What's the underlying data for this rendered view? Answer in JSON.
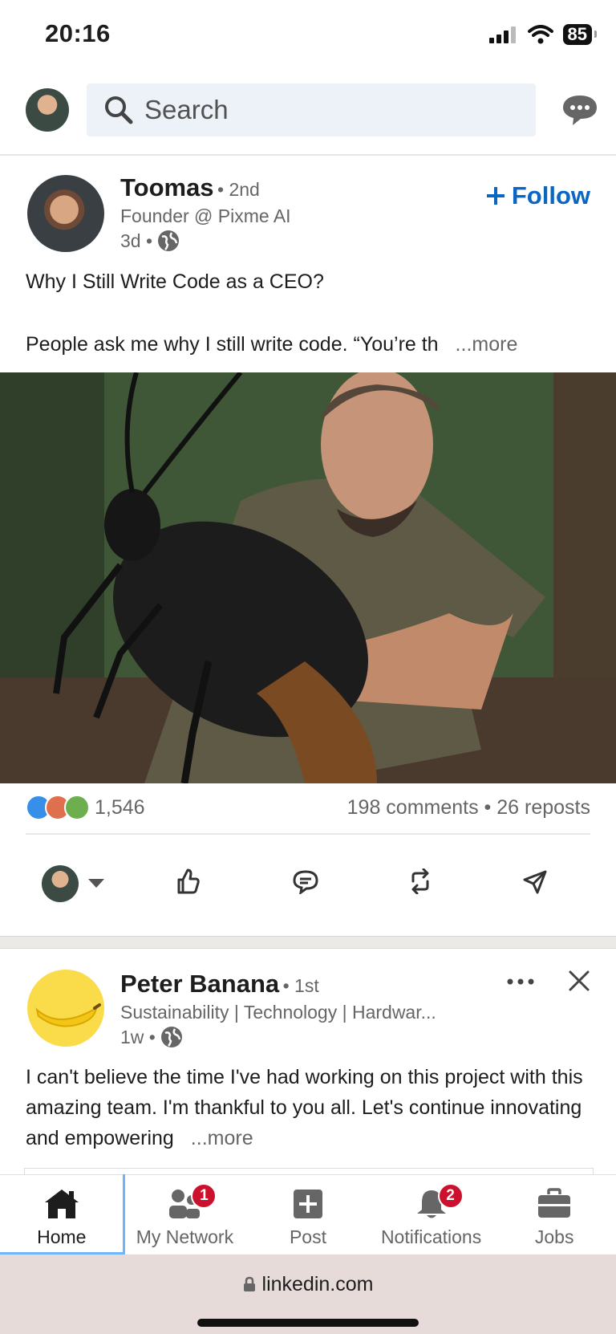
{
  "status_bar": {
    "time": "20:16",
    "battery": "85"
  },
  "header": {
    "search_placeholder": "Search"
  },
  "posts": [
    {
      "author": "Toomas",
      "degree": "• 2nd",
      "headline": "Founder @ Pixme AI",
      "time": "3d •",
      "follow_label": "Follow",
      "title": "Why I Still Write Code as a CEO?",
      "text": "People ask me why I still write code. “You’re th",
      "more": "...more",
      "reaction_count": "1,546",
      "comments_reposts": "198 comments • 26 reposts"
    },
    {
      "author": "Peter Banana",
      "degree": "• 1st",
      "headline": "Sustainability | Technology | Hardwar...",
      "time": "1w •",
      "text": "I can't believe the time I've had working on this project with this amazing team. I'm thankful to you all. Let's continue innovating and empowering",
      "more": "...more"
    }
  ],
  "bottom_nav": [
    {
      "label": "Home",
      "icon": "home-icon"
    },
    {
      "label": "My Network",
      "icon": "people-icon",
      "badge": "1"
    },
    {
      "label": "Post",
      "icon": "plus-square-icon"
    },
    {
      "label": "Notifications",
      "icon": "bell-icon",
      "badge": "2"
    },
    {
      "label": "Jobs",
      "icon": "briefcase-icon"
    }
  ],
  "browser": {
    "url": "linkedin.com"
  },
  "colors": {
    "brand_blue": "#0a66c2",
    "badge_red": "#cb112d",
    "focus_outline": "#70b5f9"
  }
}
